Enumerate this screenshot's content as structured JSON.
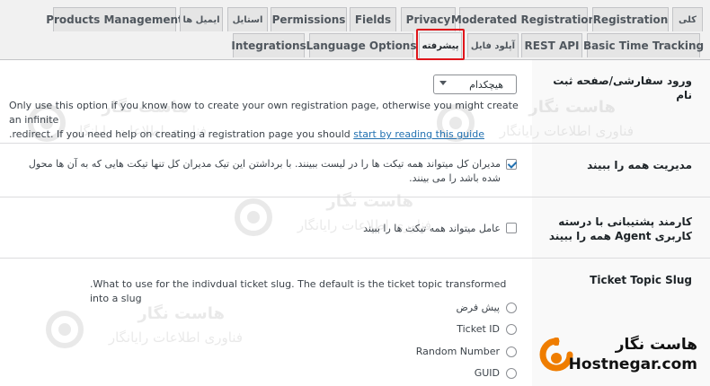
{
  "tabs_row1": [
    "Products Management",
    "ایمیل ها",
    "استایل",
    "Permissions",
    "Fields",
    "Privacy",
    "Moderated Registration",
    "Registration",
    "کلی"
  ],
  "tabs_row2": [
    "Integrations",
    "Language Options",
    "پیشرفته",
    "آپلود فایل",
    "REST API",
    "Basic Time Tracking"
  ],
  "accent_color": "#e0151b",
  "registration_page": {
    "label": "ورود سفارشی/صفحه ثبت نام",
    "select_value": "هیچکدام",
    "help_line1": "Only use this option if you know how to create your own registration page, otherwise you might create an infinite",
    "help_line2_prefix": ".redirect. If you need help on creating a registration page you should ",
    "help_link": "start by reading this guide"
  },
  "admins_see_all": {
    "label": "مدیریت همه را ببیند",
    "text_line1": "مدیران کل میتواند همه تیکت ها را در لیست ببینند. با برداشتن این تیک مدیران کل تنها تیکت هایی که به آن ها محول",
    "text_line2": "شده باشد را می بینند."
  },
  "agents_see_all": {
    "label_line1": "کارمند پشتیبانی با درسته",
    "label_line2": "کاربری Agent همه را ببیند",
    "text": "عامل میتواند همه تیکت ها را ببیند"
  },
  "ticket_topic_slug": {
    "label": "Ticket Topic Slug",
    "description": ".What to use for the indivdual ticket slug. The default is the ticket topic transformed into a slug",
    "options": [
      "پیش فرض",
      "Ticket ID",
      "Random Number",
      "GUID"
    ]
  },
  "watermark": {
    "title": "هاست نگار",
    "subtitle": "فناوری اطلاعات رایانگار"
  },
  "logo": {
    "fa": "هاست نگار",
    "en": "Hostnegar.com"
  }
}
